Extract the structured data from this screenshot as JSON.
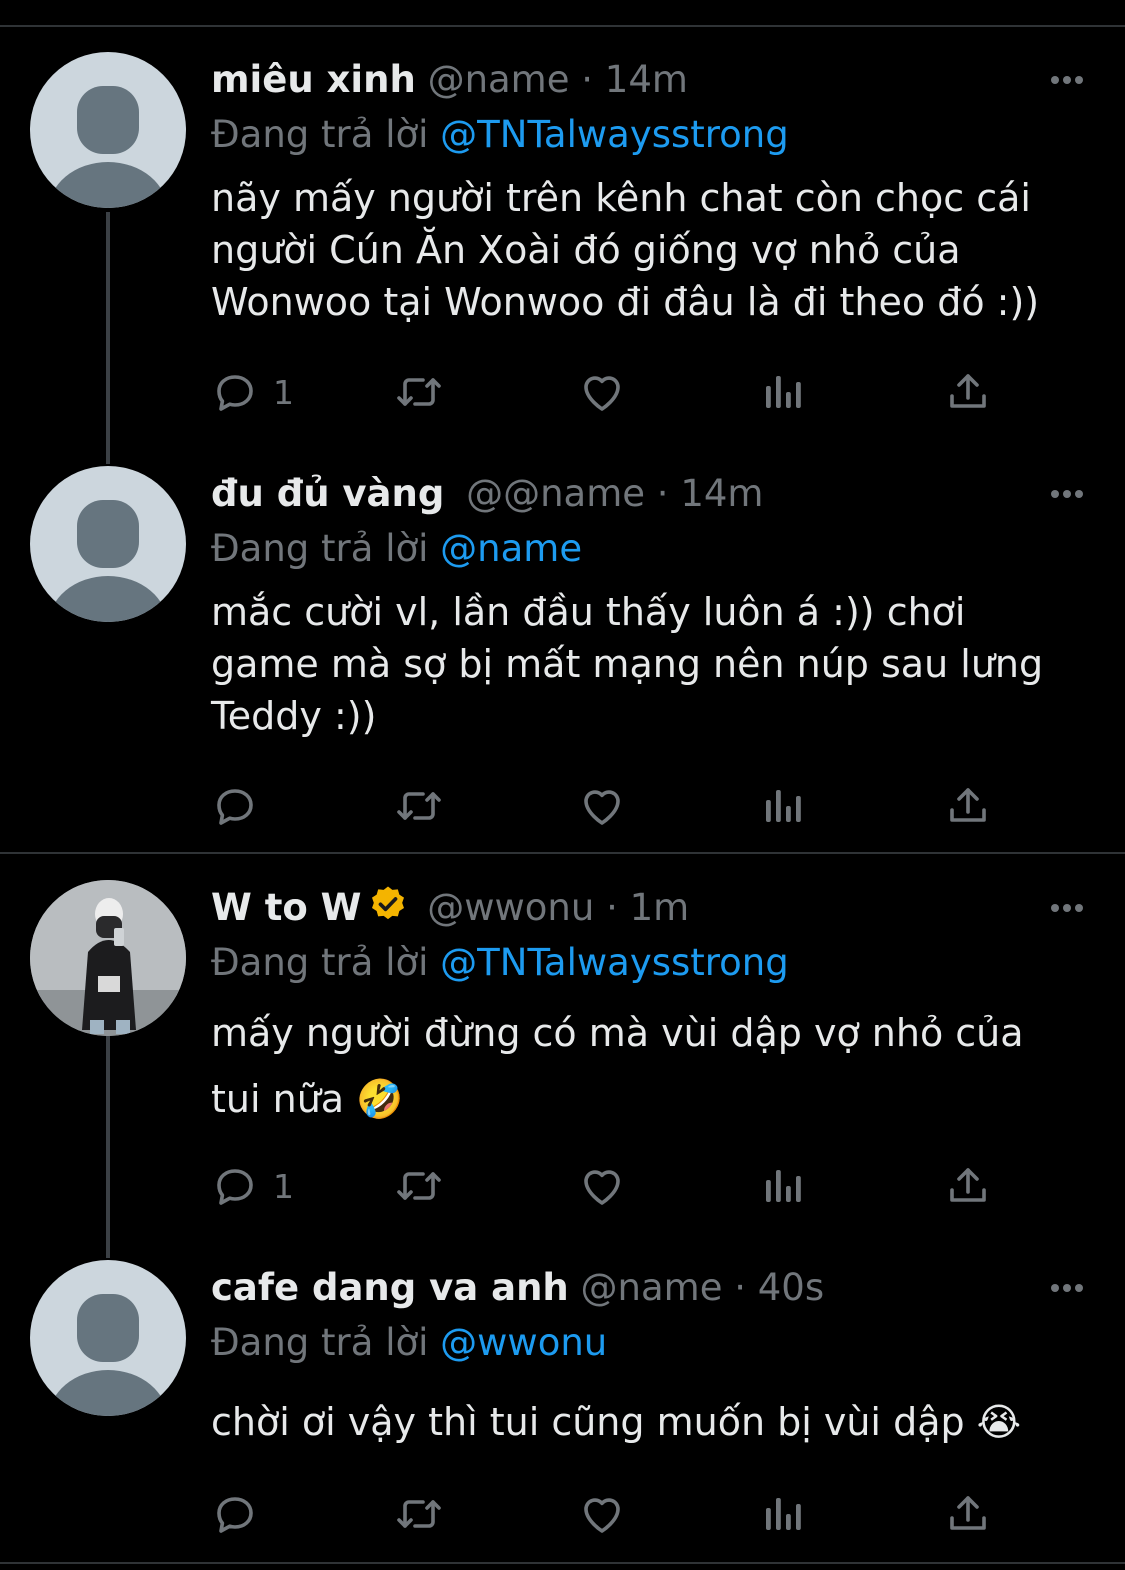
{
  "tweets": [
    {
      "name": "miêu xinh",
      "handle": "@name",
      "time": "14m",
      "reply_label": "Đang trả lời",
      "reply_to": "@TNTalwaysstrong",
      "text": "nãy mấy người trên kênh chat còn chọc cái\nngười Cún Ăn Xoài đó giống vợ nhỏ của\nWonwoo tại Wonwoo đi đâu là đi theo đó :))",
      "reply_count": "1",
      "icons": [
        "reply-icon",
        "retweet-icon",
        "like-icon",
        "views-icon",
        "share-icon"
      ]
    },
    {
      "name": "đu đủ vàng",
      "handle": "@@name",
      "time": "14m",
      "reply_label": "Đang trả lời",
      "reply_to": "@name",
      "text": "mắc cười vl, lần đầu thấy luôn á :)) chơi\ngame mà sợ bị mất mạng nên núp sau lưng\nTeddy :))",
      "reply_count": ""
    },
    {
      "name": "W to W",
      "handle": "@wwonu",
      "time": "1m",
      "reply_label": "Đang trả lời",
      "reply_to": "@TNTalwaysstrong",
      "text": "mấy người đừng có mà vùi dập vợ nhỏ của\ntui nữa 🤣",
      "reply_count": "1",
      "verified_color": "#f4b400"
    },
    {
      "name": "cafe dang va anh",
      "handle": "@name",
      "time": "40s",
      "reply_label": "Đang trả lời",
      "reply_to": "@wwonu",
      "text": "chời ơi vậy thì tui cũng muốn bị vùi dập 😭",
      "reply_count": ""
    }
  ],
  "separator": "·",
  "colors": {
    "background": "#000000",
    "text": "#e7e9ea",
    "muted": "#71767b",
    "accent": "#1d9bf0",
    "divider": "#2f3336"
  }
}
